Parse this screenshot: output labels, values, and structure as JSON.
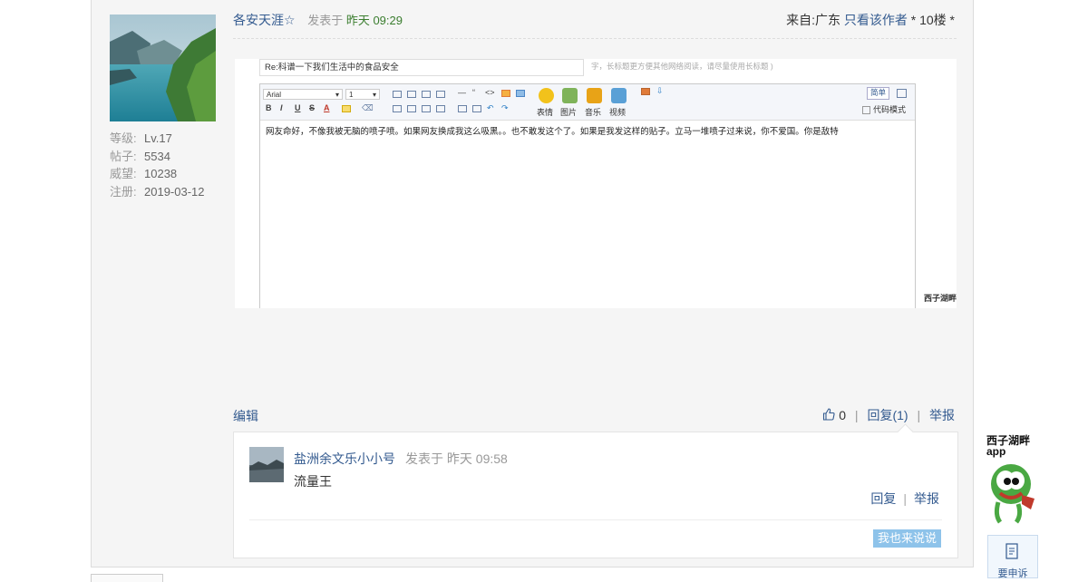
{
  "post": {
    "author": "各安天涯☆",
    "posted_label": "发表于",
    "posted_time": "昨天 09:29",
    "location": "来自:广东",
    "only_author": "只看该作者",
    "floor": "* 10楼 *",
    "user_stats": [
      {
        "label": "等级:",
        "value": "Lv.17"
      },
      {
        "label": "帖子:",
        "value": "5534"
      },
      {
        "label": "威望:",
        "value": "10238"
      },
      {
        "label": "注册:",
        "value": "2019-03-12"
      }
    ]
  },
  "screenshot": {
    "title_value": "Re:科谱一下我们生活中的食品安全",
    "title_hint": "字，长标题更方便其他网络阅读，请尽量使用长标题 )",
    "font_select": "Arial",
    "size_select": "1",
    "row1_glyphs": [
      "—",
      "“",
      "<>"
    ],
    "row2_glyphs": [
      "B",
      "I",
      "U",
      "S",
      "A",
      "⌫"
    ],
    "media_buttons": [
      {
        "label": "表情",
        "icon": "smiley-icon",
        "color": "#f2c21b"
      },
      {
        "label": "图片",
        "icon": "image-icon",
        "color": "#7fb35a"
      },
      {
        "label": "音乐",
        "icon": "music-icon",
        "color": "#e8a317"
      },
      {
        "label": "视频",
        "icon": "video-icon",
        "color": "#5aa0d6"
      }
    ],
    "simple_label": "简单",
    "code_mode_label": "代码模式",
    "body_text": "网友命好，不像我被无脑的喷子喷。如果网友换成我这么吸黑。。也不敢发这个了。如果是我发这样的贴子。立马一堆喷子过来说，你不爱国。你是敌特",
    "watermark": "西子湖畔"
  },
  "actions": {
    "edit": "编辑",
    "like_count": "0",
    "reply": "回复(1)",
    "report": "举报"
  },
  "reply": {
    "name": "盐洲余文乐小小号",
    "posted": "发表于 昨天 09:58",
    "text": "流量王",
    "reply_label": "回复",
    "report_label": "举报",
    "say_button": "我也来说说"
  },
  "side": {
    "brand_line1": "西子湖畔",
    "brand_line2": "app",
    "appeal_label": "要申诉"
  },
  "colors": {
    "link": "#335a8f",
    "time_green": "#3a7d2e",
    "say_button": "#8ec3ea"
  }
}
